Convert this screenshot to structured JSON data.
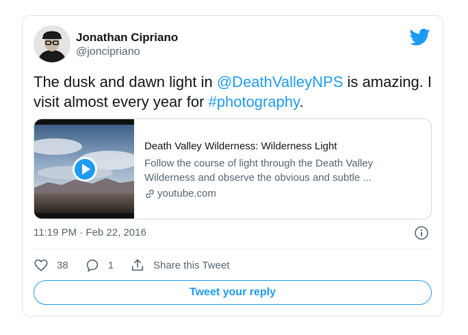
{
  "author": {
    "name": "Jonathan Cipriano",
    "handle": "@joncipriano"
  },
  "tweet": {
    "text_before": "The dusk and dawn light in ",
    "mention": "@DeathValleyNPS",
    "text_middle": " is amazing. I visit almost every year for ",
    "hashtag": "#photography",
    "text_after": "."
  },
  "link_preview": {
    "title": "Death Valley Wilderness: Wilderness Light",
    "description": "Follow the course of light through the Death Valley Wilderness and observe the obvious and subtle ...",
    "domain": "youtube.com",
    "thumbnail": "death-valley-video-thumbnail",
    "overlay_icon": "play-icon"
  },
  "meta": {
    "timestamp": "11:19 PM · Feb 22, 2016"
  },
  "actions": {
    "likes": "38",
    "replies": "1",
    "share_label": "Share this Tweet"
  },
  "reply_button": {
    "label": "Tweet your reply"
  },
  "colors": {
    "accent": "#1d9bf0",
    "text": "#0f1419",
    "secondary": "#536471",
    "border": "#cfd9de"
  }
}
